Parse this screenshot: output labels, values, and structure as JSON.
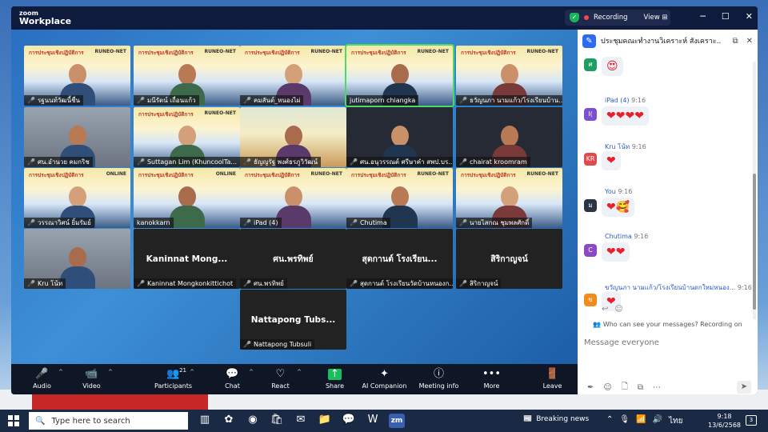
{
  "app": {
    "logo_line1": "zoom",
    "logo_line2": "Workplace",
    "recording_label": "Recording",
    "view_label": "View"
  },
  "tiles": [
    {
      "name": "รฐนนท์วัฒนี้ชื่น",
      "bg": "slide",
      "slide_title": "การประชุมเชิงปฏิบัติการ",
      "muted": true
    },
    {
      "name": "มนีรัตน์ เถื่อนแก้ว",
      "bg": "slide",
      "slide_title": "การประชุมเชิงปฏิบัติการ",
      "muted": true
    },
    {
      "name": "คมสันต์_หนองไผ่",
      "bg": "slide",
      "slide_title": "การประชุมเชิงปฏิบัติการ",
      "muted": true
    },
    {
      "name": "jutimaporn chiangka",
      "bg": "slide",
      "slide_title": "การประชุมเชิงปฏิบัติการ",
      "muted": false,
      "active": true
    },
    {
      "name": "ธวัญนภา นามแก้ว/โรงเรียนบ้าน...",
      "bg": "slide",
      "slide_title": "การประชุมเชิงปฏิบัติการ",
      "muted": true
    },
    {
      "name": "ศน.อำนวย คมกริช",
      "bg": "room",
      "muted": true
    },
    {
      "name": "Suttagan Lim (KhuncoolTa...",
      "bg": "slide",
      "slide_title": "การประชุมเชิงปฏิบัติการ",
      "muted": true
    },
    {
      "name": "ธัญญรัฐ พงศ์ธรภูวิวัฒน์",
      "bg": "slidecenter",
      "muted": true
    },
    {
      "name": "ศน.อนุวรรณต์ ศรีษาคำ สพป.บร...",
      "bg": "dark",
      "muted": true
    },
    {
      "name": "chairat kroomram",
      "bg": "dark",
      "muted": true
    },
    {
      "name": "วรรณาวิศน์ ยิ้มรัมย์",
      "bg": "slide",
      "slide_title": "การประชุมเชิงปฏิบัติการ",
      "muted": true
    },
    {
      "name": "kanokkarn",
      "bg": "slide",
      "slide_title": "การประชุมเชิงปฏิบัติการ",
      "muted": false
    },
    {
      "name": "iPad (4)",
      "bg": "slide",
      "slide_title": "การประชุมเชิงปฏิบัติการ",
      "muted": true
    },
    {
      "name": "Chutima",
      "bg": "slide",
      "slide_title": "การประชุมเชิงปฏิบัติการ",
      "muted": true
    },
    {
      "name": "นายไสกณ ชุมพลศักดิ์",
      "bg": "slide",
      "slide_title": "การประชุมเชิงปฏิบัติการ",
      "muted": true
    },
    {
      "name": "Kru โน้ท",
      "bg": "room",
      "muted": true
    },
    {
      "name": "Kaninnat Mongkonkittichot",
      "big": "Kaninnat  Mong...",
      "bg": "name",
      "muted": true
    },
    {
      "name": "ศน.พรทิพย์",
      "big": "ศน.พรทิพย์",
      "bg": "name",
      "muted": true
    },
    {
      "name": "สุดกานต์ โรงเรียนวัดบ้านหนองก...",
      "big": "สุดกานต์ โรงเรียน...",
      "bg": "name",
      "muted": true
    },
    {
      "name": "สิริกาญจน์",
      "big": "สิริกาญจน์",
      "bg": "name",
      "muted": true
    },
    {
      "name": "Nattapong Tubsuli",
      "big": "Nattapong  Tubs...",
      "bg": "name",
      "muted": true
    }
  ],
  "slide_label_online": "ONLINE",
  "slide_label_runeo": "RUNEO-NET",
  "toolbar": [
    {
      "label": "Audio",
      "icon": "🎤",
      "name": "audio",
      "caret": true
    },
    {
      "label": "Video",
      "icon": "📹",
      "name": "video",
      "caret": true
    },
    {
      "label": "Participants",
      "icon": "👥",
      "name": "participants",
      "caret": true,
      "count": "21"
    },
    {
      "label": "Chat",
      "icon": "💬",
      "name": "chat",
      "caret": true
    },
    {
      "label": "React",
      "icon": "♡",
      "name": "react",
      "caret": true
    },
    {
      "label": "Share",
      "icon": "↑",
      "name": "share"
    },
    {
      "label": "AI Companion",
      "icon": "✦",
      "name": "ai-companion"
    },
    {
      "label": "Meeting info",
      "icon": "ⓘ",
      "name": "meeting-info"
    },
    {
      "label": "More",
      "icon": "•••",
      "name": "more"
    },
    {
      "label": "Leave",
      "icon": "🚪",
      "name": "leave"
    }
  ],
  "chat": {
    "title": "ประชุมคณะทำงานวิเคราะห์ สังเคราะ...",
    "messages": [
      {
        "avatar": "ศ",
        "color": "#1f9e62",
        "sender": "",
        "time": "",
        "content": "😍"
      },
      {
        "avatar": "I(",
        "color": "#7b4fd0",
        "sender": "iPad (4)",
        "time": "9:16",
        "content": "❤❤❤❤"
      },
      {
        "avatar": "KR",
        "color": "#e14a4a",
        "sender": "Kru โน้ท",
        "time": "9:16",
        "content": "❤"
      },
      {
        "avatar": "ม",
        "color": "#2b3445",
        "sender": "You",
        "time": "9:16",
        "content": "❤🥰"
      },
      {
        "avatar": "C",
        "color": "#8b49c8",
        "sender": "Chutima",
        "time": "9:16",
        "content": "❤❤"
      },
      {
        "avatar": "ข",
        "color": "#f08b1c",
        "sender": "ขวัญนภา นามแก้ว/โรงเรียนบ้านดกใหม่หนอง...",
        "time": "9:16",
        "content": "❤"
      }
    ],
    "who_text": "Who can see your messages? Recording on",
    "input_placeholder": "Message everyone"
  },
  "taskbar": {
    "search_placeholder": "Type here to search",
    "news_label": "Breaking news",
    "lang": "ไทย",
    "time": "9:18",
    "date": "13/6/2568",
    "notif_count": "3"
  }
}
